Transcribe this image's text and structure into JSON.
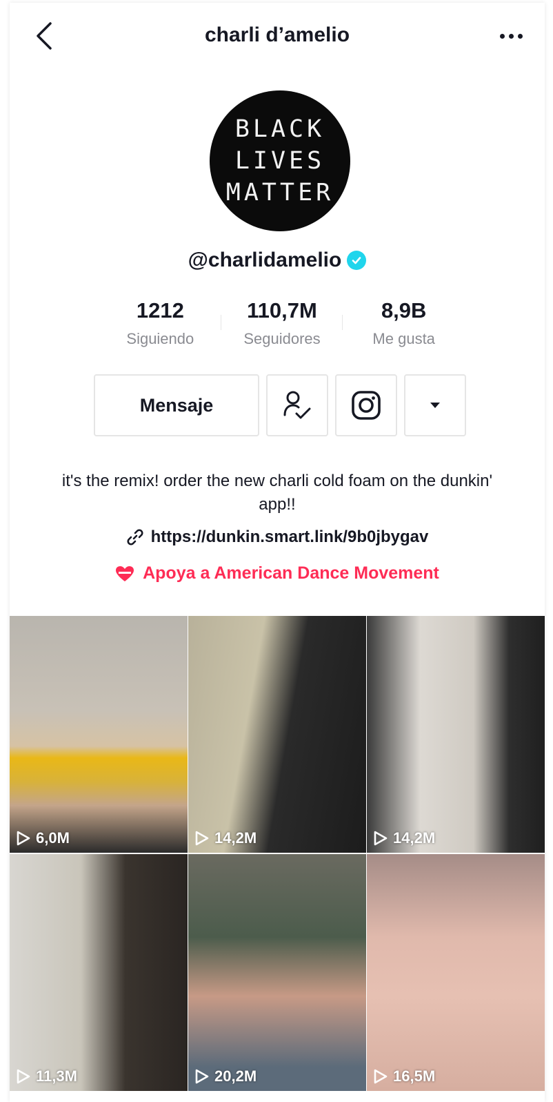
{
  "header": {
    "title": "charli d’amelio",
    "back_icon": "chevron-left-icon",
    "more_icon": "ellipsis-horizontal-icon"
  },
  "profile": {
    "avatar_text": [
      "BLACK",
      "LIVES",
      "MATTER"
    ],
    "handle": "@charlidamelio",
    "verified_color": "#20d5ec"
  },
  "stats": [
    {
      "value": "1212",
      "label": "Siguiendo"
    },
    {
      "value": "110,7M",
      "label": "Seguidores"
    },
    {
      "value": "8,9B",
      "label": "Me gusta"
    }
  ],
  "actions": {
    "message_label": "Mensaje",
    "following_icon": "user-check-icon",
    "instagram_icon": "instagram-icon",
    "dropdown_icon": "caret-down-icon"
  },
  "bio": {
    "text": "it's the remix! order the new charli cold foam on the dunkin' app!!",
    "link": "https://dunkin.smart.link/9b0jbygav",
    "charity": "Apoya a American Dance Movement",
    "charity_color": "#fe2c55"
  },
  "videos": [
    {
      "views": "6,0M"
    },
    {
      "views": "14,2M"
    },
    {
      "views": "14,2M"
    },
    {
      "views": "11,3M"
    },
    {
      "views": "20,2M"
    },
    {
      "views": "16,5M"
    }
  ]
}
